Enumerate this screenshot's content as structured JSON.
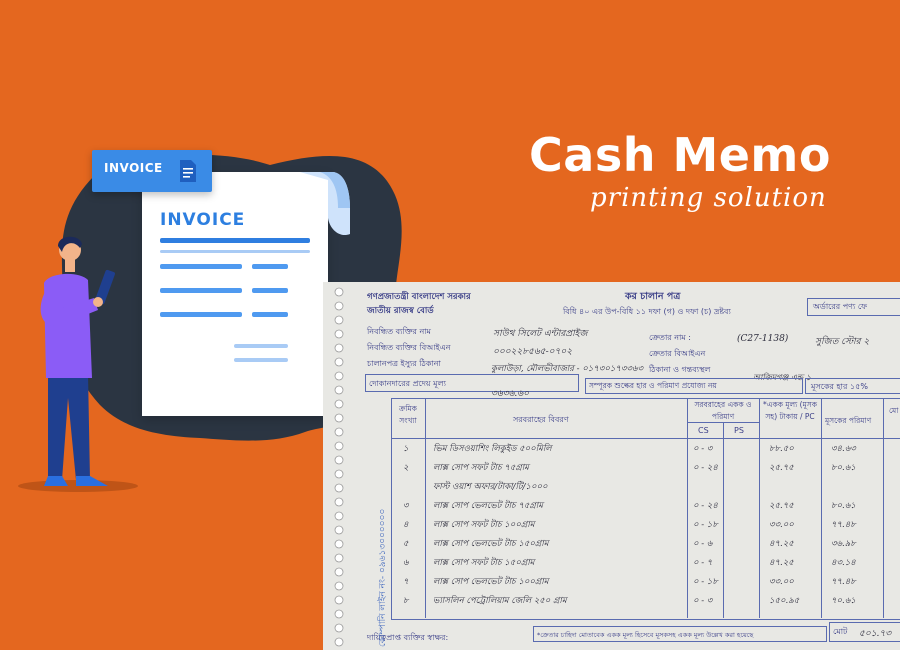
{
  "title": "Cash Memo",
  "subtitle": "printing solution",
  "illustration": {
    "tag_label": "INVOICE",
    "doc_title": "INVOICE"
  },
  "memo": {
    "header_left_1": "গণপ্রজাতন্ত্রী বাংলাদেশ সরকার",
    "header_left_2": "জাতীয় রাজস্ব বোর্ড",
    "header_center_1": "কর চালান পত্র",
    "header_center_2": "বিধি ৪০ এর উপ-বিধি ১১ দফা (গ) ও দফা (চ) দ্রষ্টব্য",
    "header_right": "অর্ডারের পণ্য ফে",
    "label_reg_name": "নিবন্ধিত ব্যক্তির নাম",
    "label_reg_bin": "নিবন্ধিত ব্যক্তির বিআইএন",
    "label_address": "চালানপত্র ইস্যুর ঠিকানা",
    "label_shop_price": "দোকানদারের প্রদেয় মূল্য",
    "value_name": "সাউথ সিলেট এন্টারপ্রাইজ",
    "value_bin": "০০০২২৮৫৬৫-০৭০২",
    "value_address": "কুলাউড়া, মৌলভীবাজার - ০১৭৩০১৭৩৩৬৩",
    "value_shop_price": "৩৬৩৬.৬০",
    "label_buyer_name": "ক্রেতার নাম :",
    "label_buyer_bin": "ক্রেতার বিআইএন",
    "label_buyer_address": "ঠিকানা ও গন্তব্যস্থল",
    "value_buyer_code": "(C27-1138)",
    "value_buyer_name": "সুজিত স্টোর ২",
    "value_destination": "আজিমগঞ্জ এন্ড ১",
    "supp_label": "সম্পূরক শুল্কের হার ও  পরিমাণ প্রযোজ্য নয়",
    "vat_rate": "মূসকের হার ১৫%",
    "col_serial": "ক্রমিক সংখ্যা",
    "col_desc": "সরবরাহের বিবরণ",
    "col_qty": "সরবরাহের একক ও পরিমাণ",
    "col_cs": "CS",
    "col_ps": "PS",
    "col_unit_price": "*একক মূল্য (মূসক সহ) টাকায় / PC",
    "col_vat_amount": "মূসকের পরিমাণ",
    "col_extra": "মো",
    "side_note": "কোম্পানি লাইন নং- ০৯৬১৩০০০০০০",
    "footer_sign": "দায়িত্বপ্রাপ্ত ব্যক্তির স্বাক্ষর:",
    "footer_note": "*ক্রেতার চাহিদা মোতাবেক একক মূল্য হিসেবে মূসকসহ একক মূল্য উল্লেখ করা হয়েছে",
    "total_label": "মোট",
    "total_value": "৫০১.৭৩",
    "rows": [
      {
        "sn": "১",
        "desc": "ভিম ডিসওয়াশিং লিকুইড ৫০০মিলি",
        "qty": "০ - ৩",
        "price": "৮৮.৫০",
        "vat": "৩৪.৬৩"
      },
      {
        "sn": "২",
        "desc": "লাক্স সোপ সফট টাচ ৭৫গ্রাম",
        "qty": "০ - ২৪",
        "price": "২৫.৭৫",
        "vat": "৮০.৬১"
      },
      {
        "sn": "",
        "desc": "ফাস্ট ওয়াশ অফার/টাকা/টি/১০০০",
        "qty": "",
        "price": "",
        "vat": ""
      },
      {
        "sn": "৩",
        "desc": "লাক্স সোপ ভেলভেট টাচ ৭৫গ্রাম",
        "qty": "০ - ২৪",
        "price": "২৫.৭৫",
        "vat": "৮০.৬১"
      },
      {
        "sn": "৪",
        "desc": "লাক্স সোপ সফট টাচ ১০০গ্রাম",
        "qty": "০ - ১৮",
        "price": "৩৩.০০",
        "vat": "৭৭.৪৮"
      },
      {
        "sn": "৫",
        "desc": "লাক্স সোপ ভেলভেট টাচ ১৫০গ্রাম",
        "qty": "০ - ৬",
        "price": "৪৭.২৫",
        "vat": "৩৬.৯৮"
      },
      {
        "sn": "৬",
        "desc": "লাক্স সোপ সফট টাচ ১৫০গ্রাম",
        "qty": "০ - ৭",
        "price": "৪৭.২৫",
        "vat": "৪৩.১৪"
      },
      {
        "sn": "৭",
        "desc": "লাক্স সোপ ভেলভেট টাচ ১০০গ্রাম",
        "qty": "০ - ১৮",
        "price": "৩৩.০০",
        "vat": "৭৭.৪৮"
      },
      {
        "sn": "৮",
        "desc": "ভ্যাসলিন পেট্রোলিয়াম জেলি ২৫০ গ্রাম",
        "qty": "০ - ৩",
        "price": "১৫০.৯৫",
        "vat": "৭০.৬১"
      }
    ]
  },
  "colors": {
    "background": "#e4671f",
    "blob": "#2b3542",
    "accent_blue": "#3a8be6",
    "text_white": "#ffffff",
    "ink": "#3b3f88"
  }
}
